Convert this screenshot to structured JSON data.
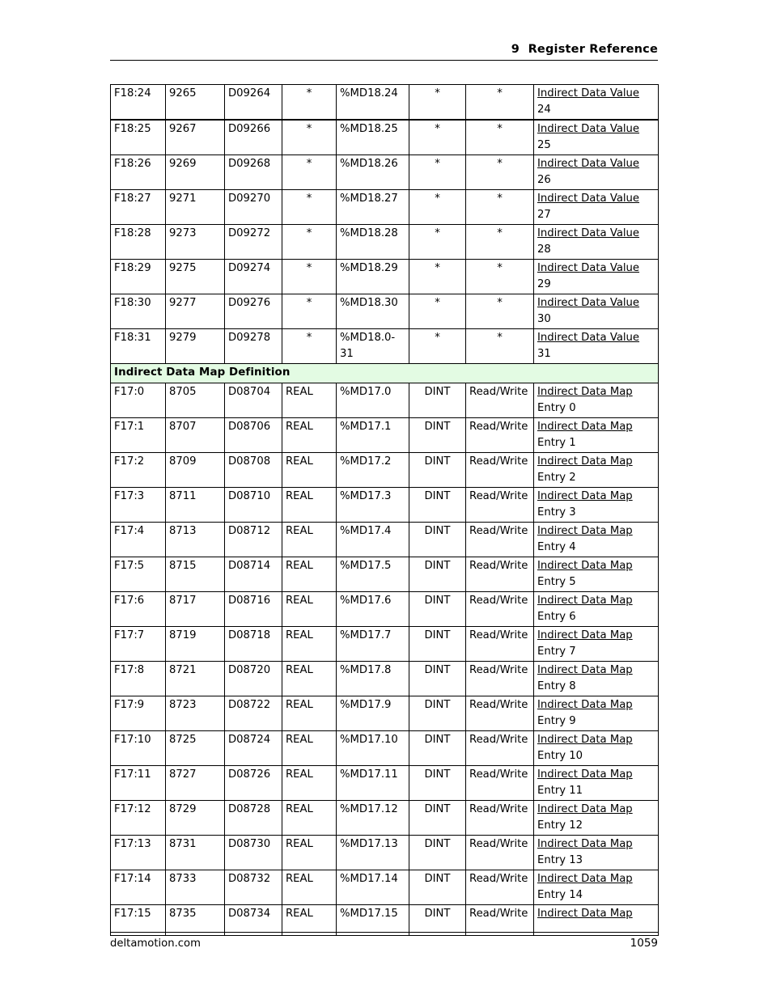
{
  "header": {
    "chapter_number": "9",
    "chapter_title": "Register Reference",
    "combined": "9  Register Reference"
  },
  "footer": {
    "site": "deltamotion.com",
    "page_number": "1059"
  },
  "colors": {
    "section_band": "#e3fbe3",
    "text": "#000000",
    "rule": "#000000"
  },
  "table": {
    "sections": [
      {
        "id": "indirect-data-values",
        "heading": null,
        "rows": [
          {
            "axis": "F18:24",
            "modbus": "9265",
            "dn": "D09264",
            "type": "*",
            "md": "%MD18.24",
            "plc_type": "*",
            "access": "*",
            "desc1": "Indirect Data Value",
            "desc2": "24"
          },
          {
            "axis": "F18:25",
            "modbus": "9267",
            "dn": "D09266",
            "type": "*",
            "md": "%MD18.25",
            "plc_type": "*",
            "access": "*",
            "desc1": "Indirect Data Value",
            "desc2": "25"
          },
          {
            "axis": "F18:26",
            "modbus": "9269",
            "dn": "D09268",
            "type": "*",
            "md": "%MD18.26",
            "plc_type": "*",
            "access": "*",
            "desc1": "Indirect Data Value",
            "desc2": "26"
          },
          {
            "axis": "F18:27",
            "modbus": "9271",
            "dn": "D09270",
            "type": "*",
            "md": "%MD18.27",
            "plc_type": "*",
            "access": "*",
            "desc1": "Indirect Data Value",
            "desc2": "27"
          },
          {
            "axis": "F18:28",
            "modbus": "9273",
            "dn": "D09272",
            "type": "*",
            "md": "%MD18.28",
            "plc_type": "*",
            "access": "*",
            "desc1": "Indirect Data Value",
            "desc2": "28"
          },
          {
            "axis": "F18:29",
            "modbus": "9275",
            "dn": "D09274",
            "type": "*",
            "md": "%MD18.29",
            "plc_type": "*",
            "access": "*",
            "desc1": "Indirect Data Value",
            "desc2": "29"
          },
          {
            "axis": "F18:30",
            "modbus": "9277",
            "dn": "D09276",
            "type": "*",
            "md": "%MD18.30",
            "plc_type": "*",
            "access": "*",
            "desc1": "Indirect Data Value",
            "desc2": "30"
          },
          {
            "axis": "F18:31",
            "modbus": "9279",
            "dn": "D09278",
            "type": "*",
            "md": "%MD18.0-31",
            "plc_type": "*",
            "access": "*",
            "desc1": "Indirect Data Value",
            "desc2": "31"
          }
        ]
      },
      {
        "id": "indirect-data-map-definition",
        "heading": "Indirect Data Map Definition",
        "rows": [
          {
            "axis": "F17:0",
            "modbus": "8705",
            "dn": "D08704",
            "type": "REAL",
            "md": "%MD17.0",
            "plc_type": "DINT",
            "access": "Read/Write",
            "desc1": "Indirect Data Map",
            "desc2": "Entry 0"
          },
          {
            "axis": "F17:1",
            "modbus": "8707",
            "dn": "D08706",
            "type": "REAL",
            "md": "%MD17.1",
            "plc_type": "DINT",
            "access": "Read/Write",
            "desc1": "Indirect Data Map",
            "desc2": "Entry 1"
          },
          {
            "axis": "F17:2",
            "modbus": "8709",
            "dn": "D08708",
            "type": "REAL",
            "md": "%MD17.2",
            "plc_type": "DINT",
            "access": "Read/Write",
            "desc1": "Indirect Data Map",
            "desc2": "Entry 2"
          },
          {
            "axis": "F17:3",
            "modbus": "8711",
            "dn": "D08710",
            "type": "REAL",
            "md": "%MD17.3",
            "plc_type": "DINT",
            "access": "Read/Write",
            "desc1": "Indirect Data Map",
            "desc2": "Entry 3"
          },
          {
            "axis": "F17:4",
            "modbus": "8713",
            "dn": "D08712",
            "type": "REAL",
            "md": "%MD17.4",
            "plc_type": "DINT",
            "access": "Read/Write",
            "desc1": "Indirect Data Map",
            "desc2": "Entry 4"
          },
          {
            "axis": "F17:5",
            "modbus": "8715",
            "dn": "D08714",
            "type": "REAL",
            "md": "%MD17.5",
            "plc_type": "DINT",
            "access": "Read/Write",
            "desc1": "Indirect Data Map",
            "desc2": "Entry 5"
          },
          {
            "axis": "F17:6",
            "modbus": "8717",
            "dn": "D08716",
            "type": "REAL",
            "md": "%MD17.6",
            "plc_type": "DINT",
            "access": "Read/Write",
            "desc1": "Indirect Data Map",
            "desc2": "Entry 6"
          },
          {
            "axis": "F17:7",
            "modbus": "8719",
            "dn": "D08718",
            "type": "REAL",
            "md": "%MD17.7",
            "plc_type": "DINT",
            "access": "Read/Write",
            "desc1": "Indirect Data Map",
            "desc2": "Entry 7"
          },
          {
            "axis": "F17:8",
            "modbus": "8721",
            "dn": "D08720",
            "type": "REAL",
            "md": "%MD17.8",
            "plc_type": "DINT",
            "access": "Read/Write",
            "desc1": "Indirect Data Map",
            "desc2": "Entry 8"
          },
          {
            "axis": "F17:9",
            "modbus": "8723",
            "dn": "D08722",
            "type": "REAL",
            "md": "%MD17.9",
            "plc_type": "DINT",
            "access": "Read/Write",
            "desc1": "Indirect Data Map",
            "desc2": "Entry 9"
          },
          {
            "axis": "F17:10",
            "modbus": "8725",
            "dn": "D08724",
            "type": "REAL",
            "md": "%MD17.10",
            "plc_type": "DINT",
            "access": "Read/Write",
            "desc1": "Indirect Data Map",
            "desc2": "Entry 10"
          },
          {
            "axis": "F17:11",
            "modbus": "8727",
            "dn": "D08726",
            "type": "REAL",
            "md": "%MD17.11",
            "plc_type": "DINT",
            "access": "Read/Write",
            "desc1": "Indirect Data Map",
            "desc2": "Entry 11"
          },
          {
            "axis": "F17:12",
            "modbus": "8729",
            "dn": "D08728",
            "type": "REAL",
            "md": "%MD17.12",
            "plc_type": "DINT",
            "access": "Read/Write",
            "desc1": "Indirect Data Map",
            "desc2": "Entry 12"
          },
          {
            "axis": "F17:13",
            "modbus": "8731",
            "dn": "D08730",
            "type": "REAL",
            "md": "%MD17.13",
            "plc_type": "DINT",
            "access": "Read/Write",
            "desc1": "Indirect Data Map",
            "desc2": "Entry 13"
          },
          {
            "axis": "F17:14",
            "modbus": "8733",
            "dn": "D08732",
            "type": "REAL",
            "md": "%MD17.14",
            "plc_type": "DINT",
            "access": "Read/Write",
            "desc1": "Indirect Data Map",
            "desc2": "Entry 14"
          },
          {
            "axis": "F17:15",
            "modbus": "8735",
            "dn": "D08734",
            "type": "REAL",
            "md": "%MD17.15",
            "plc_type": "DINT",
            "access": "Read/Write",
            "desc1": "Indirect Data Map",
            "desc2": ""
          }
        ]
      }
    ]
  }
}
